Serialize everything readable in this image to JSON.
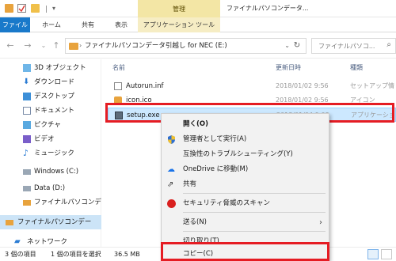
{
  "window": {
    "title": "ファイナルパソコンデータ...",
    "context_tab": "管理"
  },
  "ribbon": {
    "tabs": [
      "ファイル",
      "ホーム",
      "共有",
      "表示",
      "アプリケーション ツール"
    ]
  },
  "address": {
    "path": "ファイナルパソコンデータ引越し for NEC (E:)",
    "search_placeholder": "ファイナルパソコ..."
  },
  "navpane": {
    "items": [
      "3D オブジェクト",
      "ダウンロード",
      "デスクトップ",
      "ドキュメント",
      "ピクチャ",
      "ビデオ",
      "ミュージック",
      "Windows (C:)",
      "Data (D:)",
      "ファイナルパソコンデ",
      "ファイナルパソコンデー",
      "ネットワーク"
    ]
  },
  "content": {
    "columns": [
      "名前",
      "更新日時",
      "種類"
    ],
    "files": [
      {
        "name": "Autorun.inf",
        "date": "2018/01/02 9:56",
        "type": "セットアップ情"
      },
      {
        "name": "icon.ico",
        "date": "2018/01/02 9:56",
        "type": "アイコン"
      },
      {
        "name": "setup.exe",
        "date": "2018/01/04 9:08",
        "type": "アプリケーショ"
      }
    ]
  },
  "context_menu": {
    "items": [
      "開く(O)",
      "管理者として実行(A)",
      "互換性のトラブルシューティング(Y)",
      "OneDrive に移動(M)",
      "共有",
      "セキュリティ脅威のスキャン",
      "送る(N)",
      "切り取り(T)",
      "コピー(C)"
    ]
  },
  "statusbar": {
    "count": "3 個の項目",
    "selection": "1 個の項目を選択",
    "size": "36.5 MB"
  },
  "colors": {
    "accent": "#1979ca",
    "highlight_frame": "#e51c23",
    "selection": "#cce8ff",
    "context_tab": "#f3e6a5"
  }
}
